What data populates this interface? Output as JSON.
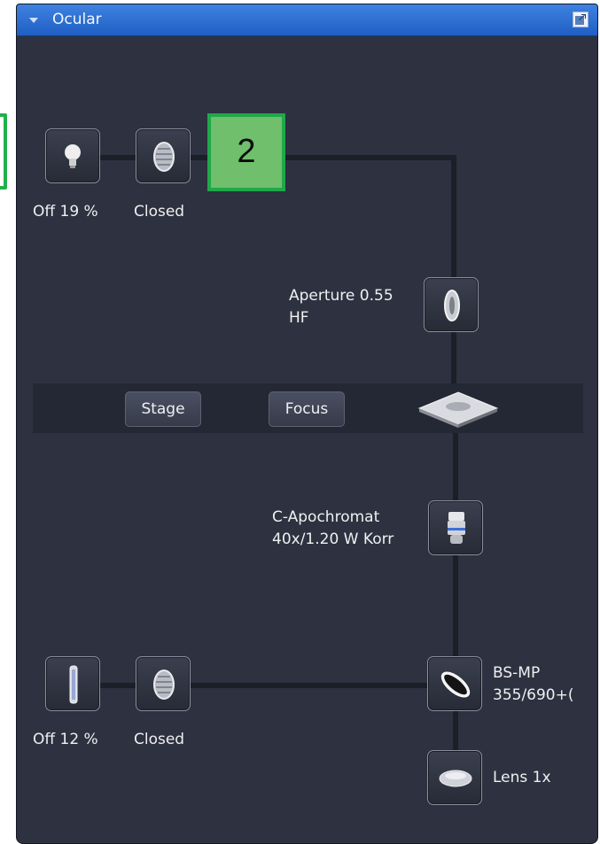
{
  "panel": {
    "title": "Ocular",
    "title_bar_color": "#2f72d6"
  },
  "callout": {
    "number": "2"
  },
  "top_path": {
    "lamp_label": "Off  19 %",
    "shutter_label": "Closed"
  },
  "aperture": {
    "line1": "Aperture 0.55",
    "line2": "HF"
  },
  "stage_controls": {
    "stage_label": "Stage",
    "focus_label": "Focus"
  },
  "objective": {
    "line1": "C-Apochromat",
    "line2": "40x/1.20 W Korr"
  },
  "bottom_path": {
    "lamp_label": "Off  12 %",
    "shutter_label": "Closed"
  },
  "beamsplitter": {
    "line1": "BS-MP",
    "line2": "355/690+("
  },
  "lens": {
    "label": "Lens 1x"
  },
  "icons": {
    "halogen_lamp": "lightbulb-icon",
    "shutter": "shutter-icon",
    "aperture": "aperture-lens-icon",
    "stage": "stage-icon",
    "objective": "objective-icon",
    "fluorescence_lamp": "tube-lamp-icon",
    "beamsplitter": "beamsplitter-icon",
    "tube_lens": "tube-lens-icon"
  }
}
